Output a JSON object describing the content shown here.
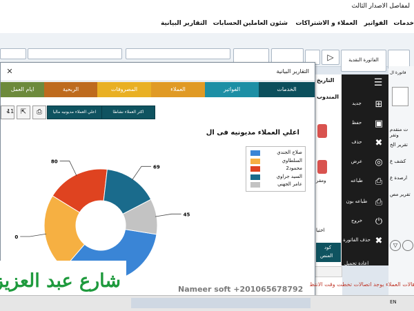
{
  "title_bar": {
    "text": "لمفاصل الاصدار الثالث"
  },
  "menu": [
    "خدمات",
    "الفواتير",
    "العملاء و الاشتراكات",
    "شئون العاملين",
    "الحسابات",
    "التقارير البيانية"
  ],
  "ribbon": {
    "invoice_button": "الفاتورة النقدية"
  },
  "report_window": {
    "title": "التقارير البيانية",
    "tabs": [
      "الخدمات",
      "الفواتير",
      "العملاء",
      "المصروفات",
      "الربحية",
      "ايام العمل"
    ],
    "sub_buttons": [
      "اكثر العملاء نشاطا",
      "اعلي العملاء مديونيه ماليا"
    ],
    "page_number": "11",
    "chart_title": "اعلي العملاء مديونيه فى ال"
  },
  "chart_data": {
    "type": "pie",
    "style": "donut",
    "title": "اعلي العملاء مديونيه فى ال",
    "categories": [
      "صلاح الجندي",
      "السلطاوي",
      "محمود2",
      "السيد جراوي",
      "عامر الجهني"
    ],
    "values": [
      150,
      100,
      80,
      69,
      45
    ],
    "colors": [
      "#3a85d6",
      "#f6b042",
      "#df4320",
      "#1a6b8c",
      "#c3c3c3"
    ],
    "label_values": [
      "100",
      "80",
      "69",
      "45"
    ],
    "legend_position": "right"
  },
  "side_panel": [
    {
      "label": "جديد",
      "icon": "plus-icon",
      "glyph": "⊞"
    },
    {
      "label": "حفظ",
      "icon": "save-icon",
      "glyph": "▣"
    },
    {
      "label": "حذف",
      "icon": "close-icon",
      "glyph": "✖"
    },
    {
      "label": "عرض",
      "icon": "view-icon",
      "glyph": "◎"
    },
    {
      "label": "طباعه",
      "icon": "print-icon",
      "glyph": "⎙"
    },
    {
      "label": "طباعه بون",
      "icon": "print-receipt-icon",
      "glyph": "⎙"
    },
    {
      "label": "خروج",
      "icon": "power-icon",
      "glyph": "⏻"
    },
    {
      "label": "حذف الفاتورة",
      "icon": "delete-invoice-icon",
      "glyph": "✖"
    },
    {
      "label": "اعادة تحميل",
      "icon": "reload-icon",
      "glyph": ""
    }
  ],
  "mid_panel": {
    "date": "التاريخ",
    "agent": "المندوب",
    "choose": "اختيا",
    "code": "كود",
    "item": "العنص",
    "other": "ومقر"
  },
  "right_col": {
    "invoice_sheet": "فاتورة ال",
    "items": [
      "ت منقدم وتفر",
      "تقرير الخ",
      "كشف ع",
      "ارصدة ع",
      "تقرير مص"
    ]
  },
  "footer": {
    "nameer": "Nameer soft +201065678792",
    "status": "هالات العملاء يوجد اتصالات تخطت وقت الانتظ",
    "lang": "EN"
  },
  "watermark": {
    "text": "شارع عبد العزيز"
  }
}
